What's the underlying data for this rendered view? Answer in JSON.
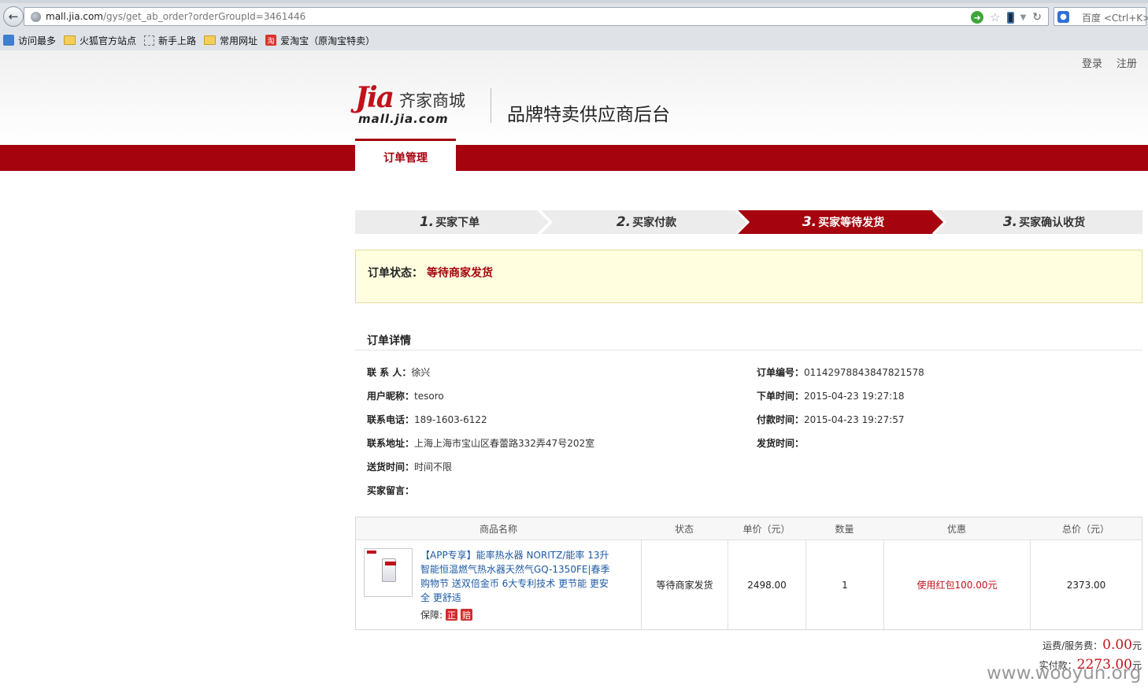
{
  "browser": {
    "url_host": "mall.jia.com",
    "url_path": "/gys/get_ab_order?orderGroupId=3461446",
    "search_placeholder": "百度 <Ctrl+K>",
    "bookmarks": [
      {
        "label": "访问最多",
        "icon": "most-visited-icon"
      },
      {
        "label": "火狐官方站点",
        "icon": "folder-icon"
      },
      {
        "label": "新手上路",
        "icon": "page-icon"
      },
      {
        "label": "常用网址",
        "icon": "folder-icon"
      },
      {
        "label": "爱淘宝（原淘宝特卖）",
        "icon": "taobao-icon"
      }
    ]
  },
  "header": {
    "top_links": {
      "login": "登录",
      "register": "注册"
    },
    "logo": {
      "jia": "Jia",
      "cn": "齐家商城",
      "domain": "mall.jia.com"
    },
    "site_title": "品牌特卖供应商后台",
    "nav_tab": "订单管理"
  },
  "steps": [
    {
      "num": "1.",
      "label": "买家下单"
    },
    {
      "num": "2.",
      "label": "买家付款"
    },
    {
      "num": "3.",
      "label": "买家等待发货"
    },
    {
      "num": "3.",
      "label": "买家确认收货"
    }
  ],
  "status": {
    "label": "订单状态：",
    "value": "等待商家发货"
  },
  "detail": {
    "title": "订单详情",
    "contact_label": "联 系 人：",
    "contact": "徐兴",
    "nickname_label": "用户昵称：",
    "nickname": "tesoro",
    "phone_label": "联系电话：",
    "phone": "189-1603-6122",
    "address_label": "联系地址：",
    "address": "上海上海市宝山区春蕾路332弄47号202室",
    "delivery_time_label": "送货时间：",
    "delivery_time": "时间不限",
    "message_label": "买家留言：",
    "message": "",
    "order_no_label": "订单编号：",
    "order_no": "01142978843847821578",
    "order_time_label": "下单时间：",
    "order_time": "2015-04-23 19:27:18",
    "pay_time_label": "付款时间：",
    "pay_time": "2015-04-23 19:27:57",
    "ship_time_label": "发货时间：",
    "ship_time": ""
  },
  "table": {
    "headers": [
      "商品名称",
      "状态",
      "单价（元）",
      "数量",
      "优惠",
      "总价（元）"
    ],
    "row": {
      "name": "【APP专享】能率热水器 NORITZ/能率 13升智能恒温燃气热水器天然气GQ-1350FE|春季购物节 送双倍金币 6大专利技术 更节能 更安全 更舒适",
      "guarantee_label": "保障:",
      "badge1": "正",
      "badge2": "赔",
      "status": "等待商家发货",
      "price": "2498.00",
      "qty": "1",
      "discount": "使用红包100.00元",
      "total": "2373.00"
    }
  },
  "summary": {
    "ship_label": "运费/服务费：",
    "ship_amount": "0.00",
    "unit": "元",
    "paid_label": "实付款：",
    "paid_amount": "2273.00"
  },
  "watermark": "www.wooyun.org",
  "colors": {
    "brand_red": "#a5030d",
    "link_blue": "#1d5aa5",
    "status_bg": "#ffffdf"
  }
}
